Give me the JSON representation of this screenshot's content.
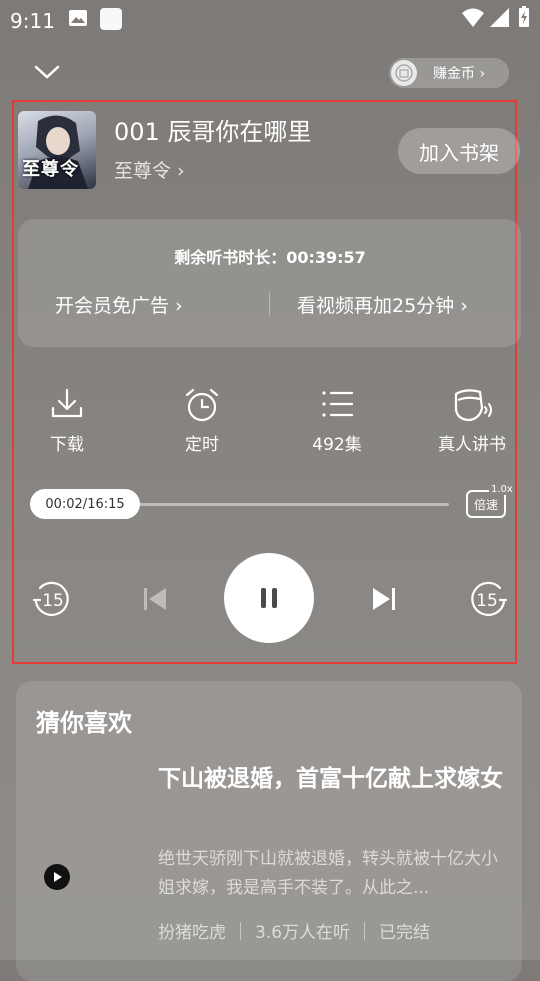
{
  "status_bar": {
    "time": "9:11"
  },
  "header": {
    "earn_label": "赚金币 ›"
  },
  "now_playing": {
    "title": "001 辰哥你在哪里",
    "author": "至尊令 ›",
    "cover_text": "至尊令",
    "add_shelf_label": "加入书架"
  },
  "listen_panel": {
    "remaining": "剩余听书时长：00:39:57",
    "vip_link": "开会员免广告 ›",
    "video_link": "看视频再加25分钟 ›"
  },
  "functions": [
    {
      "label": "下载",
      "icon": "download-icon"
    },
    {
      "label": "定时",
      "icon": "alarm-clock-icon"
    },
    {
      "label": "492集",
      "icon": "list-icon"
    },
    {
      "label": "真人讲书",
      "icon": "human-voice-icon"
    }
  ],
  "progress": {
    "time_text": "00:02/16:15",
    "fraction": 0.002,
    "speed_value": "1.0x",
    "speed_label": "倍速"
  },
  "controls": {
    "rewind_label": "15",
    "forward_label": "15"
  },
  "recommend": {
    "heading": "猜你喜欢",
    "title": "下山被退婚，首富十亿献上求嫁女",
    "description": "绝世天骄刚下山就被退婚，转头就被十亿大小姐求嫁，我是高手不装了。从此之...",
    "tags": [
      "扮猪吃虎",
      "3.6万人在听",
      "已完结"
    ]
  }
}
